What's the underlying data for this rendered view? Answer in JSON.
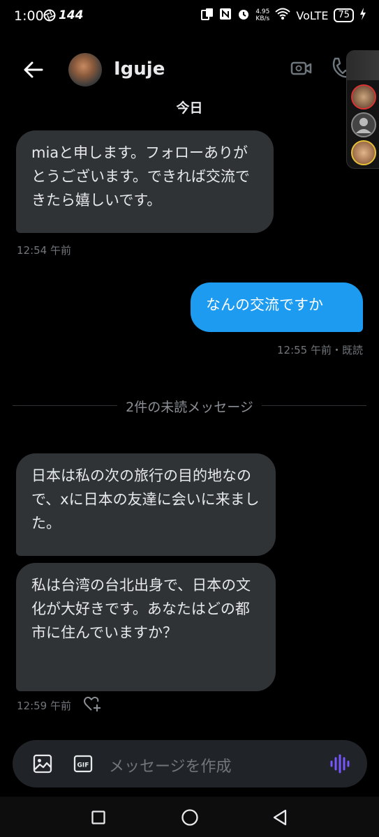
{
  "status_bar": {
    "time": "1:00",
    "refresh_rate": "144",
    "net_speed": "4.95\nKB/s",
    "network": "VoLTE",
    "battery": "75"
  },
  "header": {
    "username": "Iguje",
    "icons": [
      "back-arrow-icon",
      "video-call-icon",
      "phone-icon"
    ]
  },
  "conversation": {
    "date_label": "今日",
    "messages": [
      {
        "direction": "incoming",
        "text": "miaと申します。フォローありがとうございます。できれば交流できたら嬉しいです。",
        "time": "12:54 午前"
      },
      {
        "direction": "outgoing",
        "text": "なんの交流ですか",
        "time": "12:55 午前・既読"
      },
      {
        "direction": "incoming",
        "text": "日本は私の次の旅行の目的地なので、xに日本の友達に会いに来ました。"
      },
      {
        "direction": "incoming",
        "text": "私は台湾の台北出身で、日本の文化が大好きです。あなたはどの都市に住んでいますか？",
        "time": "12:59 午前"
      }
    ],
    "unread_divider": "2件の未読メッセージ"
  },
  "composer": {
    "placeholder": "メッセージを作成",
    "icons": [
      "image-icon",
      "gif-icon",
      "voice-icon"
    ],
    "gif_label": "GIF",
    "accent_color": "#7856ff"
  },
  "colors": {
    "outgoing_bubble": "#1d9bf0",
    "incoming_bubble": "#2f3336",
    "background": "#000000"
  }
}
